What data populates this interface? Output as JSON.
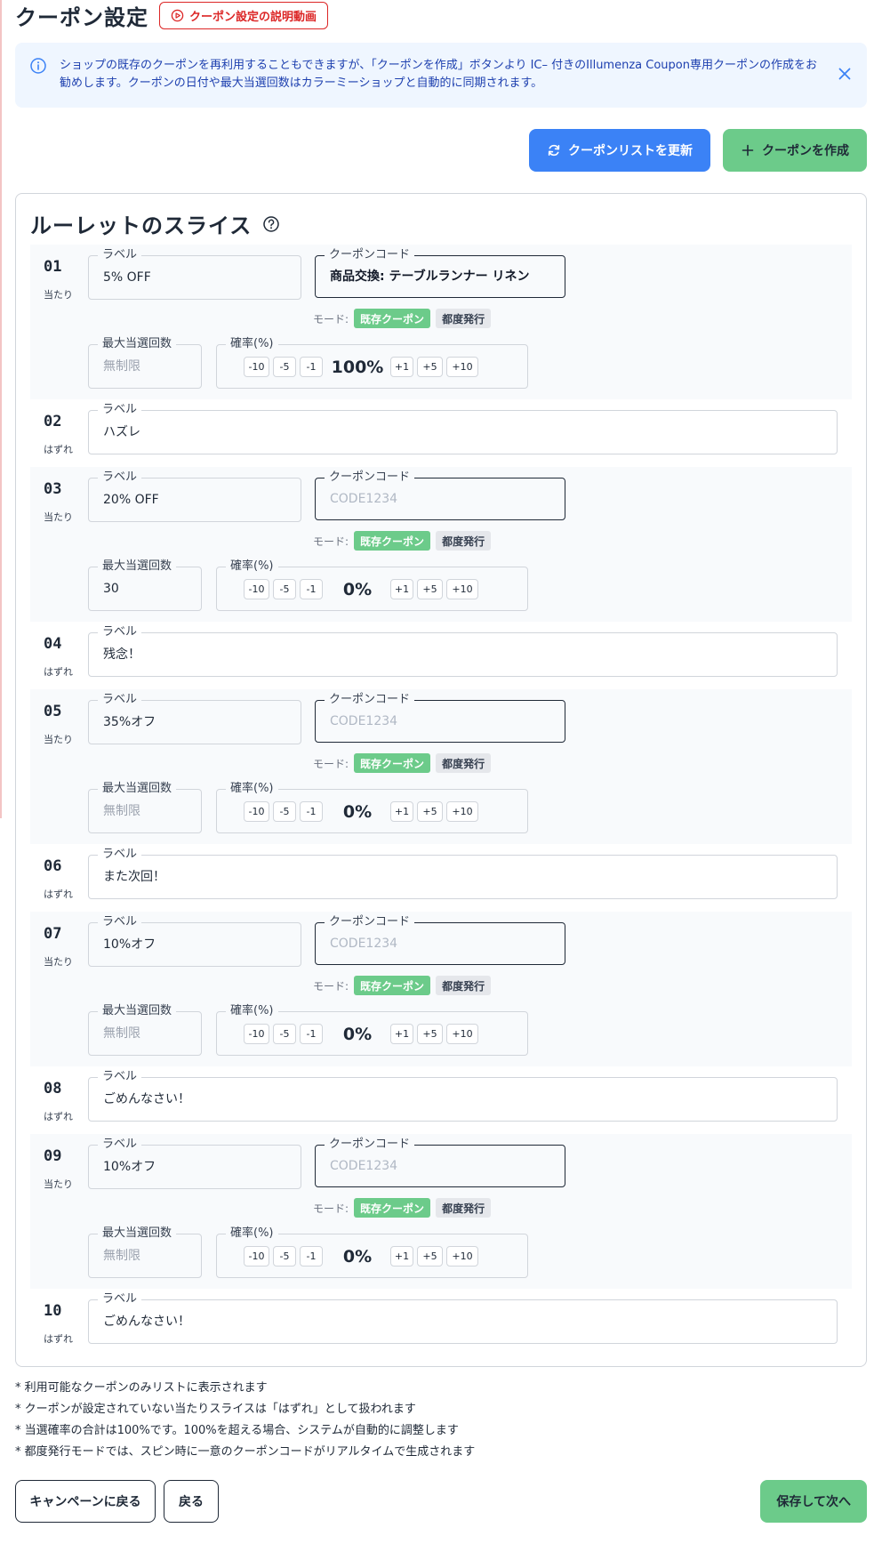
{
  "header": {
    "title": "クーポン設定",
    "video_label": "クーポン設定の説明動画"
  },
  "alert": {
    "text": "ショップの既存のクーポンを再利用することもできますが、「クーポンを作成」ボタンより IC– 付きのIllumenza Coupon専用クーポンの作成をお勧めします。クーポンの日付や最大当選回数はカラーミーショップと自動的に同期されます。"
  },
  "actions": {
    "refresh_label": "クーポンリストを更新",
    "create_label": "クーポンを作成"
  },
  "panel": {
    "title": "ルーレットのスライス"
  },
  "labels": {
    "label": "ラベル",
    "coupon_code": "クーポンコード",
    "mode": "モード:",
    "mode_existing": "既存クーポン",
    "mode_each": "都度発行",
    "max_wins": "最大当選回数",
    "probability": "確率(%)",
    "dec10": "-10",
    "dec5": "-5",
    "dec1": "-1",
    "inc1": "+1",
    "inc5": "+5",
    "inc10": "+10"
  },
  "slices": [
    {
      "number": "01",
      "kind": "当たり",
      "label": "5% OFF",
      "coupon_code": "商品交換: テーブルランナー リネン",
      "code_placeholder": "",
      "max_wins": "",
      "max_wins_placeholder": "無制限",
      "probability": "100%"
    },
    {
      "number": "02",
      "kind": "はずれ",
      "label": "ハズレ"
    },
    {
      "number": "03",
      "kind": "当たり",
      "label": "20% OFF",
      "coupon_code": "",
      "code_placeholder": "CODE1234",
      "max_wins": "30",
      "max_wins_placeholder": "",
      "probability": "0%"
    },
    {
      "number": "04",
      "kind": "はずれ",
      "label": "残念！"
    },
    {
      "number": "05",
      "kind": "当たり",
      "label": "35%オフ",
      "coupon_code": "",
      "code_placeholder": "CODE1234",
      "max_wins": "",
      "max_wins_placeholder": "無制限",
      "probability": "0%"
    },
    {
      "number": "06",
      "kind": "はずれ",
      "label": "また次回！"
    },
    {
      "number": "07",
      "kind": "当たり",
      "label": "10%オフ",
      "coupon_code": "",
      "code_placeholder": "CODE1234",
      "max_wins": "",
      "max_wins_placeholder": "無制限",
      "probability": "0%"
    },
    {
      "number": "08",
      "kind": "はずれ",
      "label": "ごめんなさい！"
    },
    {
      "number": "09",
      "kind": "当たり",
      "label": "10%オフ",
      "coupon_code": "",
      "code_placeholder": "CODE1234",
      "max_wins": "",
      "max_wins_placeholder": "無制限",
      "probability": "0%"
    },
    {
      "number": "10",
      "kind": "はずれ",
      "label": "ごめんなさい！"
    }
  ],
  "notes": [
    "* 利用可能なクーポンのみリストに表示されます",
    "* クーポンが設定されていない当たりスライスは「はずれ」として扱われます",
    "* 当選確率の合計は100%です。100%を超える場合、システムが自動的に調整します",
    "* 都度発行モードでは、スピン時に一意のクーポンコードがリアルタイムで生成されます"
  ],
  "footer": {
    "back_campaign_label": "キャンペーンに戻る",
    "back_label": "戻る",
    "save_label": "保存して次へ"
  },
  "colors": {
    "primary": "#3b82f6",
    "success": "#6ccb8a",
    "danger": "#dc2626",
    "info_bg": "#eff6ff",
    "info_text": "#1e40af"
  }
}
